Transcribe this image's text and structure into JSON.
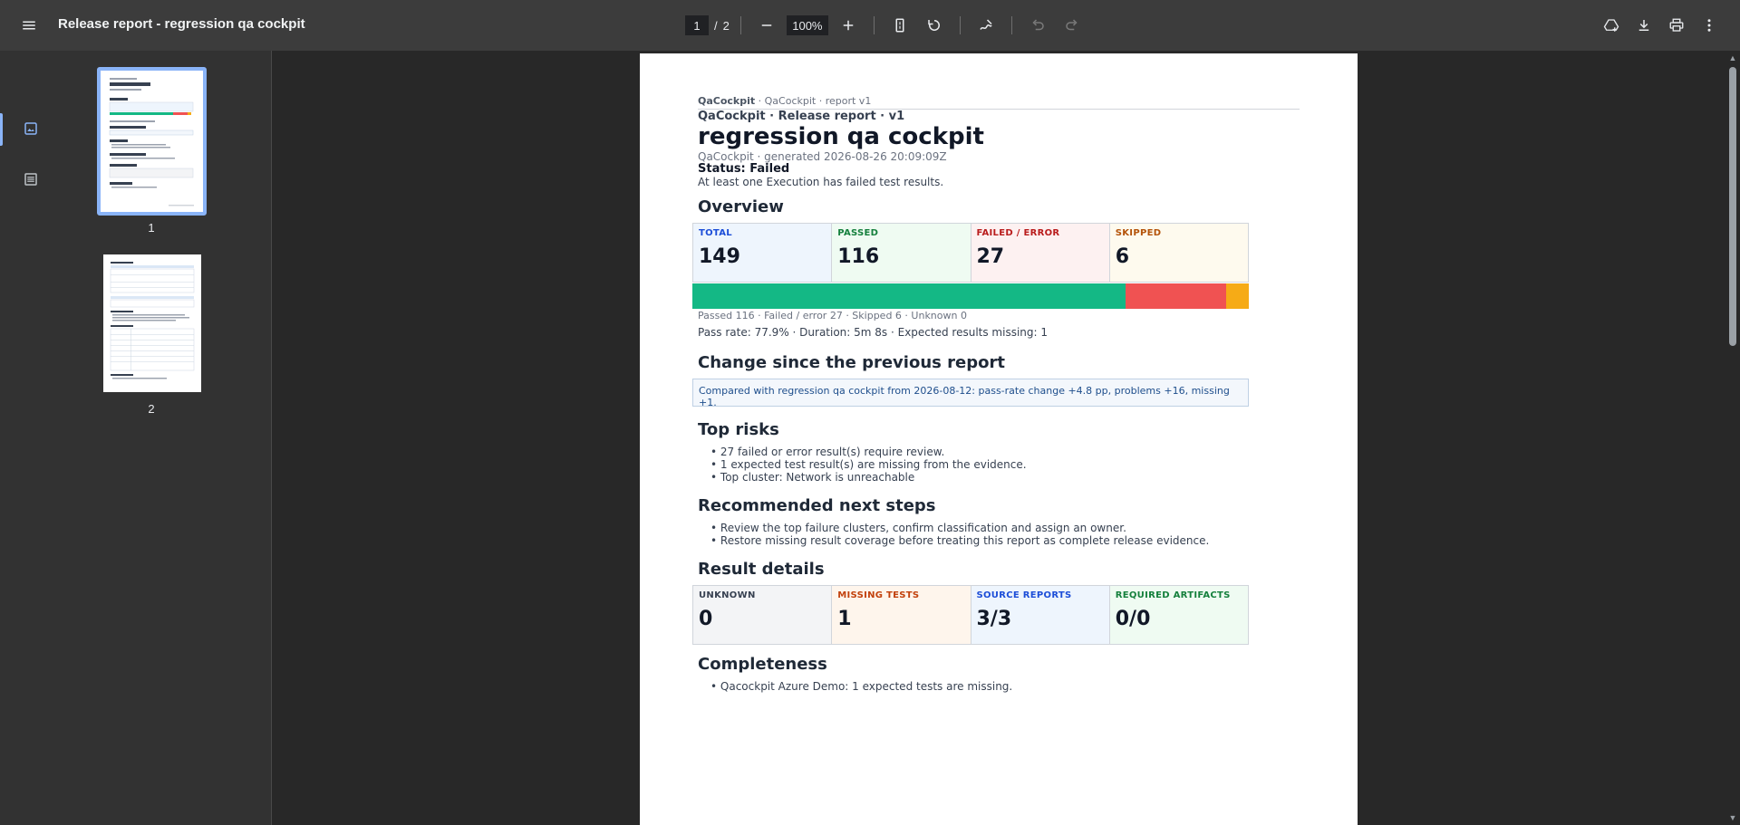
{
  "toolbar": {
    "doc_title": "Release report - regression qa cockpit",
    "page_current": "1",
    "page_separator": "/",
    "page_total": "2",
    "zoom": "100%"
  },
  "thumbnails": [
    {
      "label": "1",
      "selected": true
    },
    {
      "label": "2",
      "selected": false
    }
  ],
  "report": {
    "runhead_brand": "QaCockpit",
    "runhead_rest": " · QaCockpit · report v1",
    "kicker": "QaCockpit · Release report · v1",
    "title": "regression qa cockpit",
    "meta": "QaCockpit · generated 2026-08-26 20:09:09Z",
    "status": "Status: Failed",
    "status_desc": "At least one Execution has failed test results.",
    "overview_heading": "Overview",
    "overview_cards": [
      {
        "label": "TOTAL",
        "value": "149",
        "color": "#1d4ed8",
        "bg": "#eef5fd"
      },
      {
        "label": "PASSED",
        "value": "116",
        "color": "#15803d",
        "bg": "#effbf2"
      },
      {
        "label": "FAILED / ERROR",
        "value": "27",
        "color": "#b91c1c",
        "bg": "#fdf1f1"
      },
      {
        "label": "SKIPPED",
        "value": "6",
        "color": "#b45309",
        "bg": "#fefaee"
      }
    ],
    "bar_segments": [
      {
        "name": "passed",
        "value": 116,
        "color": "#14b885"
      },
      {
        "name": "failed",
        "value": 27,
        "color": "#f05252"
      },
      {
        "name": "skipped",
        "value": 6,
        "color": "#f6ab16"
      }
    ],
    "bar_caption": "Passed 116 · Failed / error 27 · Skipped 6 · Unknown 0",
    "pass_line": "Pass rate: 77.9% · Duration: 5m 8s · Expected results missing: 1",
    "change_heading": "Change since the previous report",
    "change_text": "Compared with regression qa cockpit from 2026-08-12: pass-rate change +4.8 pp, problems +16, missing +1.",
    "risks_heading": "Top risks",
    "risks": [
      "27 failed or error result(s) require review.",
      "1 expected test result(s) are missing from the evidence.",
      "Top cluster: Network is unreachable"
    ],
    "next_heading": "Recommended next steps",
    "next_steps": [
      "Review the top failure clusters, confirm classification and assign an owner.",
      "Restore missing result coverage before treating this report as complete release evidence."
    ],
    "details_heading": "Result details",
    "detail_cards": [
      {
        "label": "UNKNOWN",
        "value": "0",
        "color": "#374151",
        "bg": "#f3f4f6"
      },
      {
        "label": "MISSING TESTS",
        "value": "1",
        "color": "#c2410c",
        "bg": "#fef5ec"
      },
      {
        "label": "SOURCE REPORTS",
        "value": "3/3",
        "color": "#1d4ed8",
        "bg": "#eef5fd"
      },
      {
        "label": "REQUIRED ARTIFACTS",
        "value": "0/0",
        "color": "#15803d",
        "bg": "#effbf2"
      }
    ],
    "completeness_heading": "Completeness",
    "completeness": [
      "Qacockpit Azure Demo: 1 expected tests are missing."
    ]
  },
  "icons": {
    "menu": "menu-icon",
    "zoom_out": "minus-icon",
    "zoom_in": "plus-icon",
    "fit": "fit-page-icon",
    "rotate": "rotate-icon",
    "annotate": "draw-icon",
    "undo": "undo-icon",
    "redo": "redo-icon",
    "drive": "drive-add-icon",
    "download": "download-icon",
    "print": "print-icon",
    "more": "more-vert-icon"
  }
}
